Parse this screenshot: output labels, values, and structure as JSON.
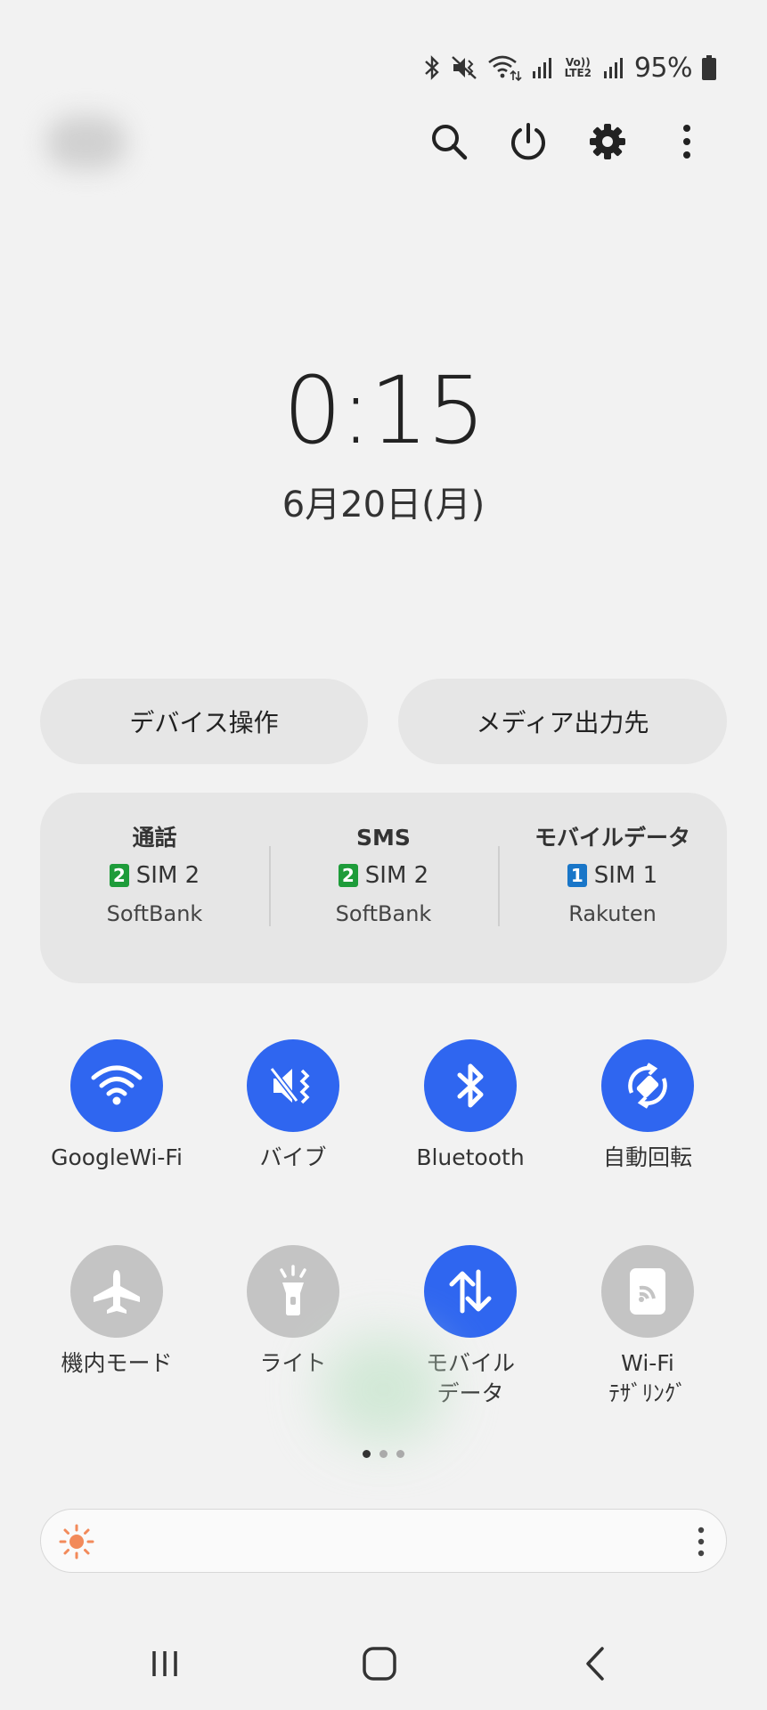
{
  "status_bar": {
    "battery_percent": "95%",
    "lte_label": "Vo)) LTE2",
    "icons": [
      "bluetooth-icon",
      "vibrate-icon",
      "wifi-icon",
      "signal-icon",
      "volte-lte-icon",
      "signal-icon",
      "battery-icon"
    ]
  },
  "top_actions": {
    "icons": [
      "search-icon",
      "power-icon",
      "settings-icon",
      "more-icon"
    ]
  },
  "clock": {
    "time": "0:15",
    "date": "6月20日(月)"
  },
  "pills": {
    "device_control": "デバイス操作",
    "media_output": "メディア出力先"
  },
  "sim_panel": {
    "columns": [
      {
        "title": "通話",
        "sim_number": "2",
        "sim_label": "SIM 2",
        "carrier": "SoftBank",
        "badge_color": "#1e9c3a"
      },
      {
        "title": "SMS",
        "sim_number": "2",
        "sim_label": "SIM 2",
        "carrier": "SoftBank",
        "badge_color": "#1e9c3a"
      },
      {
        "title": "モバイルデータ",
        "sim_number": "1",
        "sim_label": "SIM 1",
        "carrier": "Rakuten",
        "badge_color": "#1976c8"
      }
    ]
  },
  "tiles": [
    {
      "label": "GoogleWi-Fi",
      "icon": "wifi-icon",
      "state": "on"
    },
    {
      "label": "バイブ",
      "icon": "vibrate-icon",
      "state": "on"
    },
    {
      "label": "Bluetooth",
      "icon": "bluetooth-icon",
      "state": "on"
    },
    {
      "label": "自動回転",
      "icon": "auto-rotate-icon",
      "state": "on"
    },
    {
      "label": "機内モード",
      "icon": "airplane-icon",
      "state": "off"
    },
    {
      "label": "ライト",
      "icon": "flashlight-icon",
      "state": "off"
    },
    {
      "label_line1": "モバイル",
      "label_line2": "データ",
      "icon": "mobile-data-icon",
      "state": "on"
    },
    {
      "label_line1": "Wi-Fi",
      "label_line2": "ﾃｻﾞﾘﾝｸﾞ",
      "icon": "wifi-tethering-icon",
      "state": "off"
    }
  ],
  "page_indicator": {
    "total": 3,
    "current": 1
  },
  "brightness": {
    "icon": "sun-icon",
    "more_icon": "more-vertical-icon"
  },
  "nav_bar": {
    "icons": [
      "recents-icon",
      "home-icon",
      "back-icon"
    ]
  },
  "colors": {
    "accent": "#2f66f0",
    "tile_off": "#c4c4c4",
    "background": "#f2f2f2",
    "sun": "#f28a5a"
  }
}
